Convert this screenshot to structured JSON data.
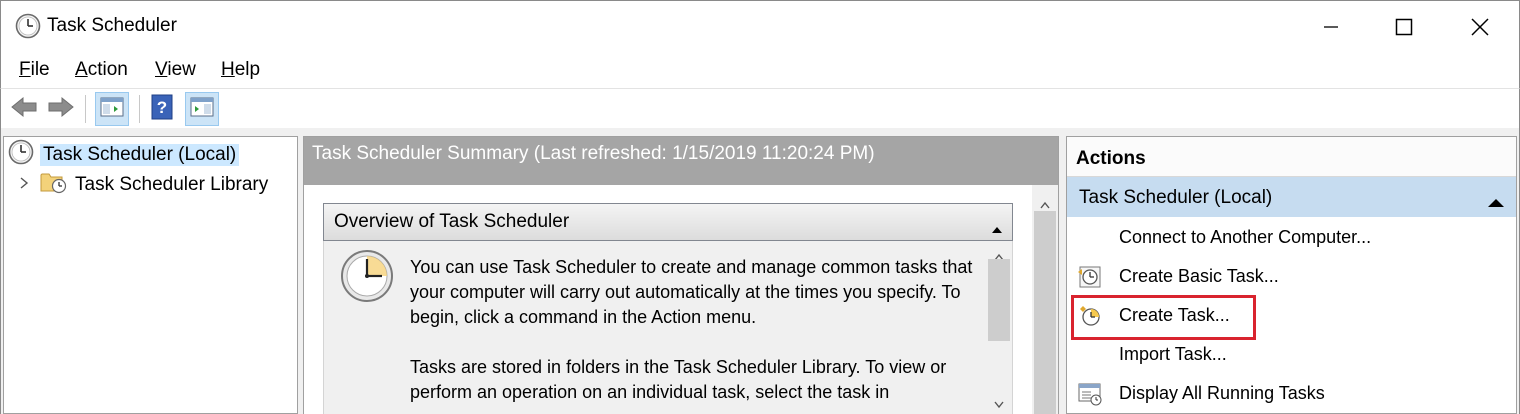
{
  "window": {
    "title": "Task Scheduler",
    "app_icon": "clock-icon",
    "controls": [
      "minimize-icon",
      "maximize-icon",
      "close-icon"
    ]
  },
  "menubar": {
    "items": [
      {
        "label": "File",
        "mnemonic": "F",
        "rest": "ile"
      },
      {
        "label": "Action",
        "mnemonic": "A",
        "rest": "ction"
      },
      {
        "label": "View",
        "mnemonic": "V",
        "rest": "iew"
      },
      {
        "label": "Help",
        "mnemonic": "H",
        "rest": "elp"
      }
    ]
  },
  "toolbar": {
    "buttons": [
      "back-arrow-icon",
      "forward-arrow-icon",
      "show-hide-console-tree-icon",
      "help-icon",
      "show-hide-action-pane-icon"
    ]
  },
  "tree": {
    "root": "Task Scheduler (Local)",
    "children": [
      "Task Scheduler Library"
    ]
  },
  "center": {
    "header": "Task Scheduler Summary (Last refreshed: 1/15/2019 11:20:24 PM)",
    "overview_title": "Overview of Task Scheduler",
    "paragraphs": [
      "You can use Task Scheduler to create and manage common tasks that your computer will carry out automatically at the times you specify. To begin, click a command in the Action menu.",
      "Tasks are stored in folders in the Task Scheduler Library. To view or perform an operation on an individual task, select the task in"
    ]
  },
  "actions": {
    "title": "Actions",
    "group": "Task Scheduler (Local)",
    "items": [
      {
        "label": "Connect to Another Computer...",
        "icon": ""
      },
      {
        "label": "Create Basic Task...",
        "icon": "basic-task-icon"
      },
      {
        "label": "Create Task...",
        "icon": "create-task-icon"
      },
      {
        "label": "Import Task...",
        "icon": ""
      },
      {
        "label": "Display All Running Tasks",
        "icon": "running-tasks-icon"
      }
    ],
    "highlighted_item": "Create Task...",
    "highlight_color": "#d9232e"
  },
  "colors": {
    "selection": "#cce8ff",
    "group_header": "#c6dcf0",
    "summary_header": "#a5a5a5"
  }
}
